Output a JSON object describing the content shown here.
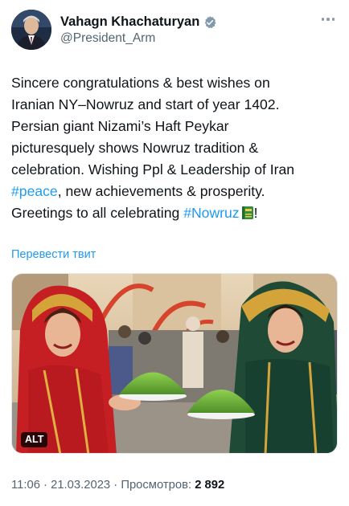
{
  "author": {
    "display_name": "Vahagn Khachaturyan",
    "handle": "@President_Arm",
    "verified_badge_icon": "verified-badge-icon"
  },
  "tweet": {
    "lines": [
      "Sincere congratulations & best wishes on",
      "Iranian NY–Nowruz and start of year 1402.",
      "Persian giant Nizami’s Haft Peykar",
      "picturesquely shows Nowruz tradition &",
      "celebration. Wishing Ppl & Leadership of Iran"
    ],
    "line6_hashtag": "#peace",
    "line6_rest": ", new achievements & prosperity.",
    "line7_start": "Greetings to all celebrating ",
    "line7_hashtag": "#Nowruz",
    "line7_end": "!",
    "emoji": "book-emoji"
  },
  "translate_label": "Перевести твит",
  "media": {
    "alt_label": "ALT",
    "description_icon": "photo-two-women-with-wheatgrass"
  },
  "meta": {
    "time": "11:06",
    "separator1": " · ",
    "date": "21.03.2023",
    "separator2": " · ",
    "views_label": "Просмотров: ",
    "views_count": "2 892"
  },
  "colors": {
    "link": "#1d9bf0",
    "text": "#0f1419",
    "secondary": "#536471"
  }
}
